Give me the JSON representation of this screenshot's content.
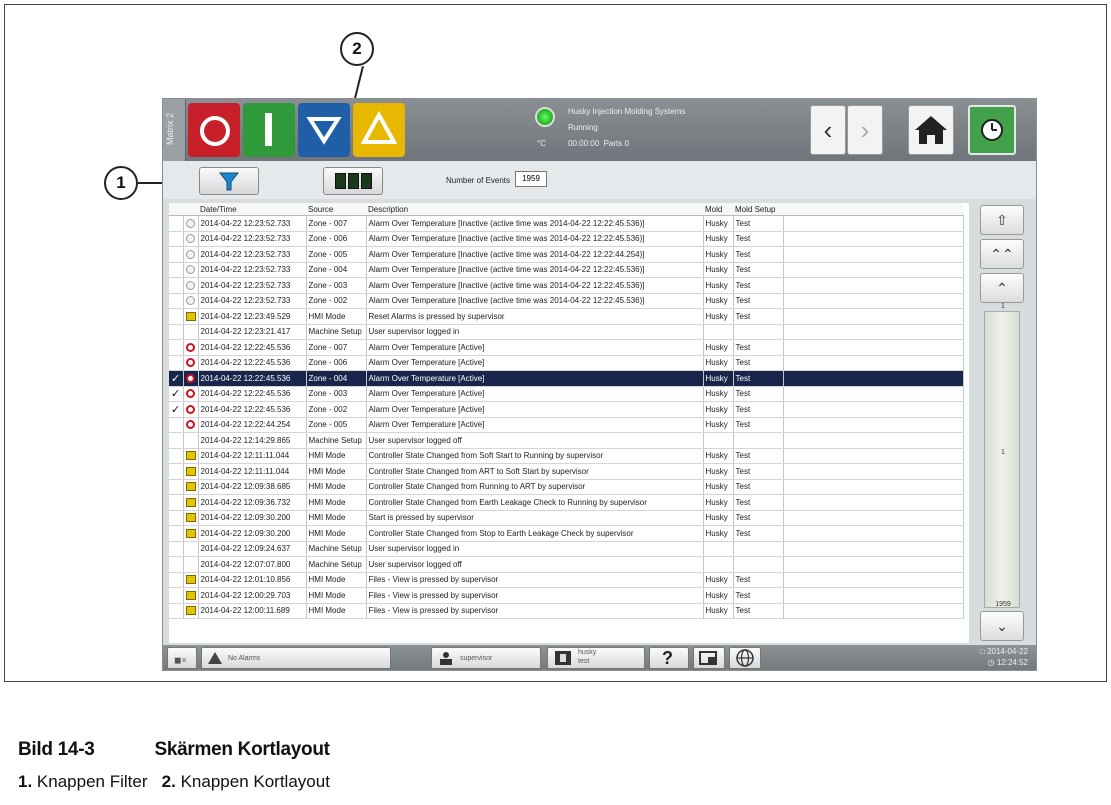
{
  "window": {
    "matrix_tab": "Matrix 2",
    "status": {
      "company": "Husky Injection Molding Systems",
      "state": "Running",
      "timer": "00:00:00",
      "parts": "Parts 0",
      "unit": "°C"
    }
  },
  "toolbar": {
    "events_label": "Number of Events",
    "events_count": "1959"
  },
  "table": {
    "columns": [
      "Date/Time",
      "Source",
      "Description",
      "Mold",
      "Mold Setup"
    ],
    "rows": [
      {
        "check": "",
        "icon": "clock",
        "datetime": "2014-04-22 12:23:52.733",
        "source": "Zone - 007",
        "description": "Alarm Over Temperature [Inactive (active time was 2014-04-22 12:22:45.536)]",
        "mold": "Husky",
        "setup": "Test"
      },
      {
        "check": "",
        "icon": "clock",
        "datetime": "2014-04-22 12:23:52.733",
        "source": "Zone - 006",
        "description": "Alarm Over Temperature [Inactive (active time was 2014-04-22 12:22:45.536)]",
        "mold": "Husky",
        "setup": "Test"
      },
      {
        "check": "",
        "icon": "clock",
        "datetime": "2014-04-22 12:23:52.733",
        "source": "Zone - 005",
        "description": "Alarm Over Temperature [Inactive (active time was 2014-04-22 12:22:44.254)]",
        "mold": "Husky",
        "setup": "Test"
      },
      {
        "check": "",
        "icon": "clock",
        "datetime": "2014-04-22 12:23:52.733",
        "source": "Zone - 004",
        "description": "Alarm Over Temperature [Inactive (active time was 2014-04-22 12:22:45.536)]",
        "mold": "Husky",
        "setup": "Test"
      },
      {
        "check": "",
        "icon": "clock",
        "datetime": "2014-04-22 12:23:52.733",
        "source": "Zone - 003",
        "description": "Alarm Over Temperature [Inactive (active time was 2014-04-22 12:22:45.536)]",
        "mold": "Husky",
        "setup": "Test"
      },
      {
        "check": "",
        "icon": "clock",
        "datetime": "2014-04-22 12:23:52.733",
        "source": "Zone - 002",
        "description": "Alarm Over Temperature [Inactive (active time was 2014-04-22 12:22:45.536)]",
        "mold": "Husky",
        "setup": "Test"
      },
      {
        "check": "",
        "icon": "hmi",
        "datetime": "2014-04-22 12:23:49.529",
        "source": "HMI Mode",
        "description": "Reset Alarms is pressed by supervisor",
        "mold": "Husky",
        "setup": "Test"
      },
      {
        "check": "",
        "icon": "",
        "datetime": "2014-04-22 12:23:21.417",
        "source": "Machine Setup",
        "description": "User supervisor logged in",
        "mold": "",
        "setup": ""
      },
      {
        "check": "",
        "icon": "alarm",
        "datetime": "2014-04-22 12:22:45.536",
        "source": "Zone - 007",
        "description": "Alarm Over Temperature [Active]",
        "mold": "Husky",
        "setup": "Test"
      },
      {
        "check": "",
        "icon": "alarm",
        "datetime": "2014-04-22 12:22:45.536",
        "source": "Zone - 006",
        "description": "Alarm Over Temperature [Active]",
        "mold": "Husky",
        "setup": "Test"
      },
      {
        "check": "✓",
        "icon": "alarm",
        "datetime": "2014-04-22 12:22:45.536",
        "source": "Zone - 004",
        "description": "Alarm Over Temperature [Active]",
        "mold": "Husky",
        "setup": "Test",
        "selected": true
      },
      {
        "check": "✓",
        "icon": "alarm",
        "datetime": "2014-04-22 12:22:45.536",
        "source": "Zone - 003",
        "description": "Alarm Over Temperature [Active]",
        "mold": "Husky",
        "setup": "Test"
      },
      {
        "check": "✓",
        "icon": "alarm",
        "datetime": "2014-04-22 12:22:45.536",
        "source": "Zone - 002",
        "description": "Alarm Over Temperature [Active]",
        "mold": "Husky",
        "setup": "Test"
      },
      {
        "check": "",
        "icon": "alarm",
        "datetime": "2014-04-22 12:22:44.254",
        "source": "Zone - 005",
        "description": "Alarm Over Temperature [Active]",
        "mold": "Husky",
        "setup": "Test"
      },
      {
        "check": "",
        "icon": "",
        "datetime": "2014-04-22 12:14:29.865",
        "source": "Machine Setup",
        "description": "User supervisor logged off",
        "mold": "",
        "setup": ""
      },
      {
        "check": "",
        "icon": "hmi",
        "datetime": "2014-04-22 12:11:11.044",
        "source": "HMI Mode",
        "description": "Controller State Changed from Soft Start to Running  by supervisor",
        "mold": "Husky",
        "setup": "Test"
      },
      {
        "check": "",
        "icon": "hmi",
        "datetime": "2014-04-22 12:11:11.044",
        "source": "HMI Mode",
        "description": "Controller State Changed from ART to Soft Start  by supervisor",
        "mold": "Husky",
        "setup": "Test"
      },
      {
        "check": "",
        "icon": "hmi",
        "datetime": "2014-04-22 12:09:38.685",
        "source": "HMI Mode",
        "description": "Controller State Changed from Running to ART  by supervisor",
        "mold": "Husky",
        "setup": "Test"
      },
      {
        "check": "",
        "icon": "hmi",
        "datetime": "2014-04-22 12:09:36.732",
        "source": "HMI Mode",
        "description": "Controller State Changed from Earth Leakage Check to Running  by supervisor",
        "mold": "Husky",
        "setup": "Test"
      },
      {
        "check": "",
        "icon": "hmi",
        "datetime": "2014-04-22 12:09:30.200",
        "source": "HMI Mode",
        "description": "Start is pressed by supervisor",
        "mold": "Husky",
        "setup": "Test"
      },
      {
        "check": "",
        "icon": "hmi",
        "datetime": "2014-04-22 12:09:30.200",
        "source": "HMI Mode",
        "description": "Controller State Changed from Stop to Earth Leakage Check  by supervisor",
        "mold": "Husky",
        "setup": "Test"
      },
      {
        "check": "",
        "icon": "",
        "datetime": "2014-04-22 12:09:24.637",
        "source": "Machine Setup",
        "description": "User supervisor logged in",
        "mold": "",
        "setup": ""
      },
      {
        "check": "",
        "icon": "",
        "datetime": "2014-04-22 12:07:07.800",
        "source": "Machine Setup",
        "description": "User supervisor logged off",
        "mold": "",
        "setup": ""
      },
      {
        "check": "",
        "icon": "hmi",
        "datetime": "2014-04-22 12:01:10.856",
        "source": "HMI Mode",
        "description": "Files - View is pressed by supervisor",
        "mold": "Husky",
        "setup": "Test"
      },
      {
        "check": "",
        "icon": "hmi",
        "datetime": "2014-04-22 12:00:29.703",
        "source": "HMI Mode",
        "description": "Files - View is pressed by supervisor",
        "mold": "Husky",
        "setup": "Test"
      },
      {
        "check": "",
        "icon": "hmi",
        "datetime": "2014-04-22 12:00:11.689",
        "source": "HMI Mode",
        "description": "Files - View is pressed by supervisor",
        "mold": "Husky",
        "setup": "Test"
      }
    ]
  },
  "scroll": {
    "page_top": "1",
    "page_mid": "1",
    "page_bottom": "1959"
  },
  "bottombar": {
    "alarms": "No Alarms",
    "user": "supervisor",
    "mold_name": "husky",
    "mold_setup": "test",
    "date": "2014-04-22",
    "time": "12:24:52"
  },
  "callouts": {
    "one": "1",
    "two": "2"
  },
  "caption": {
    "label": "Bild 14-3",
    "title": "Skärmen Kortlayout"
  },
  "legend": {
    "item1_num": "1.",
    "item1_text": "Knappen Filter",
    "item2_num": "2.",
    "item2_text": "Knappen Kortlayout"
  }
}
